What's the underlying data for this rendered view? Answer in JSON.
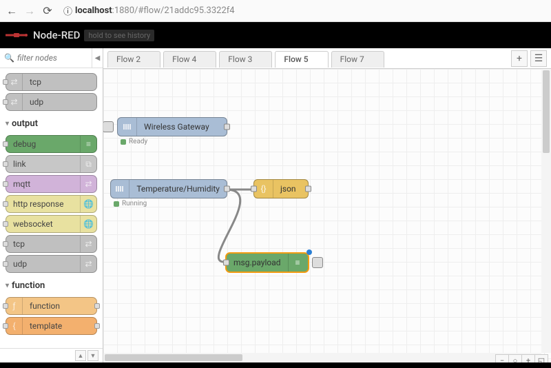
{
  "browser": {
    "url_prefix": "localhost",
    "url_rest": ":1880/#flow/21addc95.3322f4",
    "info_icon": "info-icon"
  },
  "header": {
    "brand": "Node-RED",
    "hint": "hold to see history"
  },
  "palette": {
    "search_placeholder": "filter nodes",
    "groups": [
      {
        "name": "",
        "nodes": [
          {
            "label": "tcp",
            "color": "#c0c0c0",
            "icon": "bridge-icon",
            "iconSide": "left",
            "portL": true,
            "portR": false
          },
          {
            "label": "udp",
            "color": "#c0c0c0",
            "icon": "bridge-icon",
            "iconSide": "left",
            "portL": true,
            "portR": false
          }
        ]
      },
      {
        "name": "output",
        "nodes": [
          {
            "label": "debug",
            "color": "#6aa86a",
            "icon": "bars-icon",
            "iconSide": "right",
            "portL": true,
            "portR": false
          },
          {
            "label": "link",
            "color": "#c7c7c7",
            "icon": "link-icon",
            "iconSide": "right",
            "portL": true,
            "portR": false
          },
          {
            "label": "mqtt",
            "color": "#d1b3d9",
            "icon": "bridge-icon",
            "iconSide": "right",
            "portL": true,
            "portR": false
          },
          {
            "label": "http response",
            "color": "#e8e1a0",
            "icon": "globe-icon",
            "iconSide": "right",
            "portL": true,
            "portR": false
          },
          {
            "label": "websocket",
            "color": "#e8e1a0",
            "icon": "globe-icon",
            "iconSide": "right",
            "portL": true,
            "portR": false
          },
          {
            "label": "tcp",
            "color": "#c0c0c0",
            "icon": "bridge-icon",
            "iconSide": "right",
            "portL": true,
            "portR": false
          },
          {
            "label": "udp",
            "color": "#c0c0c0",
            "icon": "bridge-icon",
            "iconSide": "right",
            "portL": true,
            "portR": false
          }
        ]
      },
      {
        "name": "function",
        "nodes": [
          {
            "label": "function",
            "color": "#f3c586",
            "icon": "f-icon",
            "iconSide": "left",
            "portL": true,
            "portR": true
          },
          {
            "label": "template",
            "color": "#f3b06e",
            "icon": "brace-icon",
            "iconSide": "left",
            "portL": true,
            "portR": true
          }
        ]
      }
    ]
  },
  "tabs": {
    "items": [
      "Flow 2",
      "Flow 4",
      "Flow 3",
      "Flow 5",
      "Flow 7"
    ],
    "active": 3
  },
  "flow_nodes": {
    "gateway": {
      "label": "Wireless Gateway",
      "status": "Ready",
      "status_color": "#6aa86a"
    },
    "temphum": {
      "label": "Temperature/Humidity",
      "status": "Running",
      "status_color": "#6aa86a"
    },
    "json": {
      "label": "json"
    },
    "debug": {
      "label": "msg.payload"
    }
  }
}
